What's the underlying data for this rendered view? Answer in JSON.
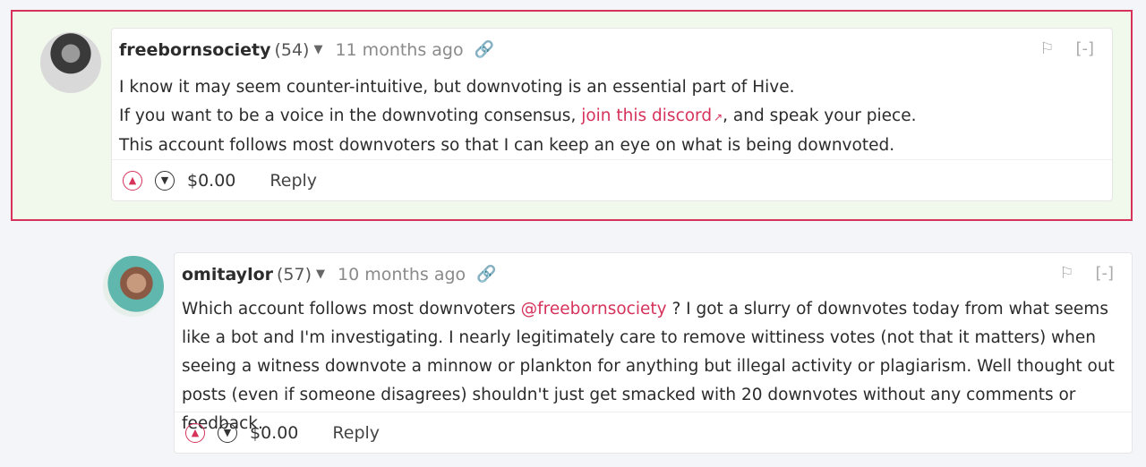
{
  "comments": [
    {
      "author": "freebornsociety",
      "rep": "(54)",
      "time": "11 months ago",
      "line1": "I know it may seem counter-intuitive, but downvoting is an essential part of Hive.",
      "line2_pre": "If you want to be a voice in the downvoting consensus, ",
      "line2_link": "join this discord",
      "line2_post": ", and speak your piece.",
      "line3": "This account follows most downvoters so that I can keep an eye on what is being downvoted.",
      "payout": "$0.00",
      "reply": "Reply",
      "collapse": "[-]"
    },
    {
      "author": "omitaylor",
      "rep": "(57)",
      "time": "10 months ago",
      "text_pre": "Which account follows most downvoters ",
      "mention": "@freebornsociety",
      "text_post": " ? I got a slurry of downvotes today from what seems like a bot and I'm investigating. I nearly legitimately care to remove wittiness votes (not that it matters) when seeing a witness downvote a minnow or plankton for anything but illegal activity or plagiarism. Well thought out posts (even if someone disagrees) shouldn't just get smacked with 20 downvotes without any comments or feedback.",
      "payout": "$0.00",
      "reply": "Reply",
      "collapse": "[-]"
    }
  ],
  "icons": [
    "link-icon",
    "flag-icon",
    "upvote-icon",
    "downvote-icon",
    "external-link-icon",
    "caret-down-icon"
  ],
  "colors": {
    "accent": "#d6325a",
    "highlight_bg": "#f1f8ec"
  }
}
